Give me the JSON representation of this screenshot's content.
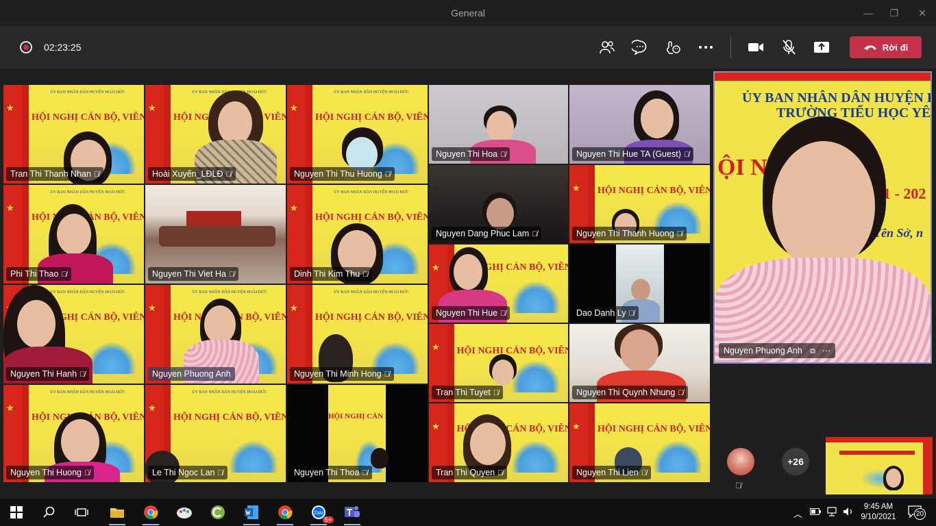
{
  "window": {
    "title": "General"
  },
  "toolbar": {
    "timer": "02:23:25",
    "leave_label": "Rời đi",
    "colors": {
      "leave": "#c4314b",
      "toolbar_bg": "#292929"
    }
  },
  "participants": [
    {
      "name": "Tran Thi Thanh Nhan",
      "muted": true
    },
    {
      "name": "Hoài Xuyến_LĐLĐ",
      "muted": true
    },
    {
      "name": "Nguyen Thi Thu Huong",
      "muted": true
    },
    {
      "name": "Nguyen Thi Hoa",
      "muted": true
    },
    {
      "name": "Nguyen Thi Hue TA (Guest)",
      "muted": true
    },
    {
      "name": "Phi Thi Thao",
      "muted": true
    },
    {
      "name": "Nguyen Thi Viet Ha",
      "muted": true
    },
    {
      "name": "Dinh Thi Kim Thu",
      "muted": true
    },
    {
      "name": "Nguyen Dang Phuc Lam",
      "muted": true
    },
    {
      "name": "Nguyen Thi Thanh Huong",
      "muted": true
    },
    {
      "name": "Nguyen Thi Hanh",
      "muted": true
    },
    {
      "name": "Nguyen Phuong Anh",
      "muted": false
    },
    {
      "name": "Nguyen Thi Minh Hong",
      "muted": true
    },
    {
      "name": "Nguyen Thi Hue",
      "muted": true
    },
    {
      "name": "Dao Danh Ly",
      "muted": true
    },
    {
      "name": "Tran Thi Tuyet",
      "muted": true
    },
    {
      "name": "Nguyen Thi Quynh Nhung",
      "muted": true
    },
    {
      "name": "Nguyen Thi Huong",
      "muted": true
    },
    {
      "name": "Le Thi Ngoc Lan",
      "muted": true
    },
    {
      "name": "Nguyen Thi Thoa",
      "muted": true
    },
    {
      "name": "Tran Thi Quyen",
      "muted": true
    },
    {
      "name": "Nguyen Thi Lien",
      "muted": true
    }
  ],
  "banner": {
    "header_line": "ỦY BAN NHÂN DÂN HUYỆN HOÀI ĐỨC",
    "title_short": "HỘI NGHỊ CÁN BỘ, VIÊN CHỨ"
  },
  "spotlight": {
    "name": "Nguyen Phuong Anh",
    "line1": "ỦY BAN NHÂN DÂN HUYỆN HO",
    "line2": "TRƯỜNG TIỂU HỌC YÊN SỞ",
    "big": "ỘI NG    BỘ, VI",
    "year": "021 - 202",
    "place": "Yên Sở, n"
  },
  "overflow": {
    "more_count": "+26"
  },
  "taskbar": {
    "time": "9:45 AM",
    "date": "9/10/2021",
    "notification_count": "20",
    "zalo_badge": "5+"
  }
}
